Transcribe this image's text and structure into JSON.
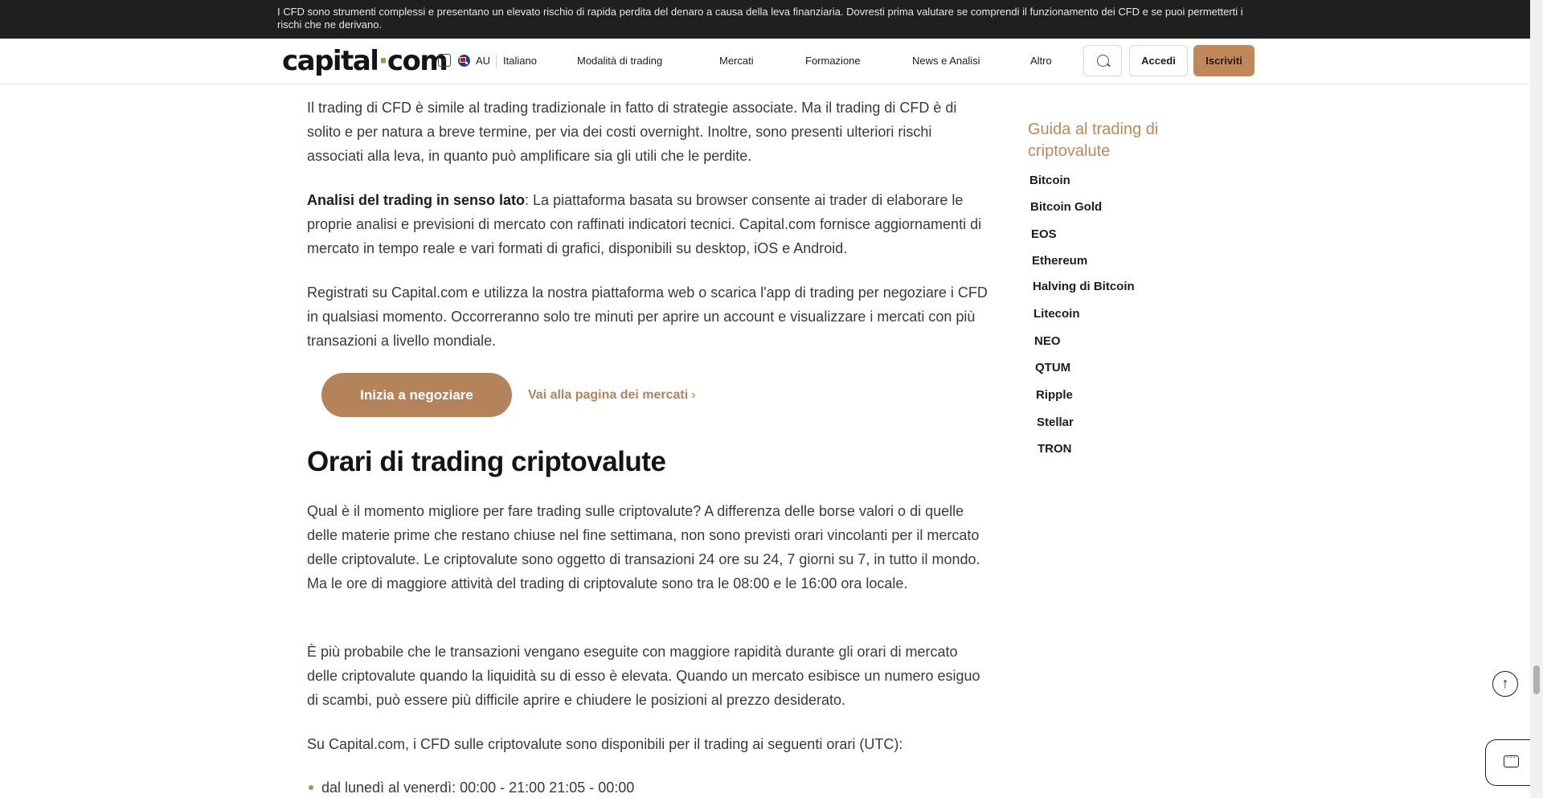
{
  "risk_banner": {
    "text": "I CFD sono strumenti complessi e presentano un elevato rischio di rapida perdita del denaro a causa della leva finanziaria. Dovresti prima valutare se comprendi il funzionamento dei CFD e se puoi permetterti i rischi che ne derivano."
  },
  "header": {
    "logo_text": "capital",
    "logo_dot": "·",
    "logo_suffix": "com",
    "region_code": "AU",
    "language": "Italiano",
    "nav_items": [
      "Modalità di trading",
      "Mercati",
      "Formazione",
      "News e Analisi",
      "Altro"
    ],
    "login_label": "Accedi",
    "signup_label": "Iscriviti"
  },
  "article": {
    "para1": "Il trading di CFD è simile al trading tradizionale in fatto di strategie associate. Ma il trading di CFD è di solito e per natura a breve termine, per via dei costi overnight. Inoltre, sono presenti ulteriori rischi associati alla leva, in quanto può amplificare sia gli utili che le perdite.",
    "para2_bold": "Analisi del trading in senso lato",
    "para2_rest": ": La piattaforma basata su browser consente ai trader di elaborare le proprie analisi e previsioni di mercato con raffinati indicatori tecnici. Capital.com fornisce aggiornamenti di mercato in tempo reale e vari formati di grafici, disponibili su desktop, iOS e Android.",
    "para3": "Registrati su Capital.com e utilizza la nostra piattaforma web o scarica l'app di trading per negoziare i CFD in qualsiasi momento. Occorreranno solo tre minuti per aprire un account e visualizzare i mercati con più transazioni a livello mondiale.",
    "cta_label": "Inizia a negoziare",
    "markets_link": "Vai alla pagina dei mercati",
    "section_title": "Orari di trading criptovalute",
    "para4": "Qual è il momento migliore per fare trading sulle criptovalute? A differenza delle borse valori o di quelle delle materie prime che restano chiuse nel fine settimana, non sono previsti orari vincolanti per il mercato delle criptovalute. Le criptovalute sono oggetto di transazioni 24 ore su 24, 7 giorni su 7, in tutto il mondo. Ma le ore di maggiore attività del trading di criptovalute sono tra le 08:00 e le 16:00 ora locale.",
    "para5": "È più probabile che le transazioni vengano eseguite con maggiore rapidità durante gli orari di mercato delle criptovalute quando la liquidità su di esso è elevata. Quando un mercato esibisce un numero esiguo di scambi, può essere più difficile aprire e chiudere le posizioni al prezzo desiderato.",
    "para6": "Su Capital.com, i CFD sulle criptovalute sono disponibili per il trading ai seguenti orari (UTC):",
    "bullet1": "dal lunedì al venerdì: 00:00 - 21:00 21:05 - 00:00"
  },
  "guide": {
    "title": "Guida al trading di criptovalute",
    "links": [
      "Bitcoin",
      "Bitcoin Gold",
      "EOS",
      "Ethereum",
      "Halving di Bitcoin",
      "Litecoin",
      "NEO",
      "QTUM",
      "Ripple",
      "Stellar",
      "TRON"
    ]
  },
  "icons": {
    "search": "search-icon",
    "chevron": "chevron-down-icon",
    "flag": "australia-flag-icon",
    "scroll_top": "arrow-up-icon",
    "chat": "chat-icon"
  },
  "colors": {
    "accent": "#c0875a",
    "cta": "#b5835a",
    "banner_bg": "#1f1f1f"
  }
}
